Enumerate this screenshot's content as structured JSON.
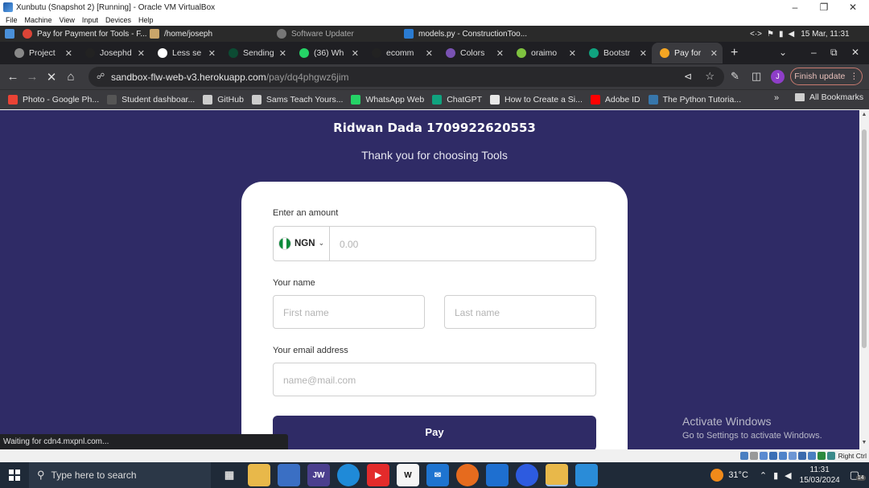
{
  "vbox": {
    "title": "Xunbutu (Snapshot 2) [Running] - Oracle VM VirtualBox",
    "menu": [
      "File",
      "Machine",
      "View",
      "Input",
      "Devices",
      "Help"
    ],
    "status_right": "Right Ctrl"
  },
  "guest_panel": {
    "windows": [
      {
        "label": "Pay for Payment for Tools - F...",
        "icon": "chrome-icon"
      },
      {
        "label": "/home/joseph",
        "icon": "folder-icon"
      },
      {
        "label": "Software Updater",
        "icon": "updater-icon"
      },
      {
        "label": "models.py - ConstructionToo...",
        "icon": "vscode-icon"
      }
    ],
    "datetime": "15 Mar, 11:31"
  },
  "tabs": [
    {
      "title": "Project",
      "favicon": "project-icon",
      "color": "#888888"
    },
    {
      "title": "Josephd",
      "favicon": "github-icon",
      "color": "#222222"
    },
    {
      "title": "Less se",
      "favicon": "google-icon",
      "color": "#ffffff"
    },
    {
      "title": "Sending",
      "favicon": "django-icon",
      "color": "#0c4b33"
    },
    {
      "title": "(36) Wh",
      "favicon": "whatsapp-icon",
      "color": "#25d366"
    },
    {
      "title": "ecomm",
      "favicon": "github-icon",
      "color": "#222222"
    },
    {
      "title": "Colors",
      "favicon": "bootstrap-icon",
      "color": "#7952b3"
    },
    {
      "title": "oraimo",
      "favicon": "oraimo-icon",
      "color": "#7ec23f"
    },
    {
      "title": "Bootstr",
      "favicon": "chatgpt-icon",
      "color": "#10a37f"
    },
    {
      "title": "Pay for",
      "favicon": "flutterwave-icon",
      "color": "#f5a623",
      "active": true
    }
  ],
  "toolbar": {
    "url_host": "sandbox-flw-web-v3.herokuapp.com",
    "url_path": "/pay/dq4phgwz6jim",
    "finish_update": "Finish update",
    "profile_initial": "J"
  },
  "bookmarks": [
    {
      "label": "Photo - Google Ph...",
      "icon": "google-photos-icon",
      "color": "#ea4335"
    },
    {
      "label": "Student dashboar...",
      "icon": "student-icon",
      "color": "#555555"
    },
    {
      "label": "GitHub",
      "icon": "github-icon",
      "color": "#cccccc"
    },
    {
      "label": "Sams Teach Yours...",
      "icon": "globe-icon",
      "color": "#cccccc"
    },
    {
      "label": "WhatsApp Web",
      "icon": "whatsapp-icon",
      "color": "#25d366"
    },
    {
      "label": "ChatGPT",
      "icon": "chatgpt-icon",
      "color": "#10a37f"
    },
    {
      "label": "How to Create a Si...",
      "icon": "doc-icon",
      "color": "#e8e8e8"
    },
    {
      "label": "Adobe ID",
      "icon": "adobe-icon",
      "color": "#ff0000"
    },
    {
      "label": "The Python Tutoria...",
      "icon": "python-icon",
      "color": "#3776ab"
    }
  ],
  "bookmarks_all": "All Bookmarks",
  "page": {
    "merchant": "Ridwan Dada 1709922620553",
    "subtitle": "Thank you for choosing Tools",
    "amount_label": "Enter an amount",
    "currency": "NGN",
    "amount_placeholder": "0.00",
    "name_label": "Your name",
    "first_name_placeholder": "First name",
    "last_name_placeholder": "Last name",
    "email_label": "Your email address",
    "email_placeholder": "name@mail.com",
    "pay_button": "Pay"
  },
  "status_tip": "Waiting for cdn4.mxpnl.com...",
  "activate": {
    "line1": "Activate Windows",
    "line2": "Go to Settings to activate Windows."
  },
  "taskbar": {
    "search_placeholder": "Type here to search",
    "weather": "31°C",
    "time": "11:31",
    "date": "15/03/2024",
    "notifications": "14"
  },
  "colors": {
    "page_bg": "#2f2b66",
    "pay_button": "#2f2b66"
  }
}
